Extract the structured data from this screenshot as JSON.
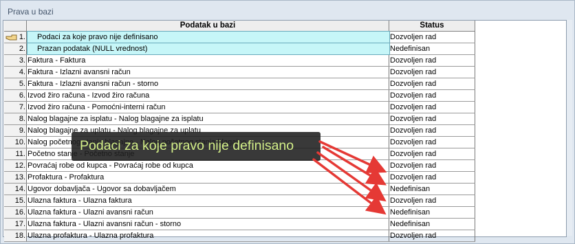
{
  "window": {
    "title": "Prava u bazi"
  },
  "table": {
    "columns": {
      "data": "Podatak u bazi",
      "status": "Status"
    },
    "rows": [
      {
        "num": "1.",
        "data": "Podaci za koje pravo nije definisano",
        "status": "Dozvoljen rad"
      },
      {
        "num": "2.",
        "data": "Prazan podatak (NULL vrednost)",
        "status": "Nedefinisan"
      },
      {
        "num": "3.",
        "data": "Faktura - Faktura",
        "status": "Dozvoljen rad"
      },
      {
        "num": "4.",
        "data": "Faktura - Izlazni avansni račun",
        "status": "Dozvoljen rad"
      },
      {
        "num": "5.",
        "data": "Faktura - Izlazni avansni račun - storno",
        "status": "Dozvoljen rad"
      },
      {
        "num": "6.",
        "data": "Izvod žiro računa - Izvod žiro računa",
        "status": "Dozvoljen rad"
      },
      {
        "num": "7.",
        "data": "Izvod žiro računa - Pomoćni-interni račun",
        "status": "Dozvoljen rad"
      },
      {
        "num": "8.",
        "data": "Nalog blagajne za isplatu - Nalog blagajne za isplatu",
        "status": "Dozvoljen rad"
      },
      {
        "num": "9.",
        "data": "Nalog blagajne za uplatu - Nalog blagajne za uplatu",
        "status": "Dozvoljen rad"
      },
      {
        "num": "10.",
        "data": "Nalog početnog stanja blagajne - Nalog početnog stanja blagajne",
        "status": "Dozvoljen rad"
      },
      {
        "num": "11.",
        "data": "Početno stanje - Početno stanje",
        "status": "Dozvoljen rad"
      },
      {
        "num": "12.",
        "data": "Povraćaj robe od kupca - Povraćaj robe od kupca",
        "status": "Dozvoljen rad"
      },
      {
        "num": "13.",
        "data": "Profaktura - Profaktura",
        "status": "Dozvoljen rad"
      },
      {
        "num": "14.",
        "data": "Ugovor dobavljača - Ugovor sa dobavljačem",
        "status": "Nedefinisan"
      },
      {
        "num": "15.",
        "data": "Ulazna faktura - Ulazna faktura",
        "status": "Dozvoljen rad"
      },
      {
        "num": "16.",
        "data": "Ulazna faktura - Ulazni avansni račun",
        "status": "Nedefinisan"
      },
      {
        "num": "17.",
        "data": "Ulazna faktura - Ulazni avansni račun - storno",
        "status": "Nedefinisan"
      },
      {
        "num": "18.",
        "data": "Ulazna profaktura - Ulazna profaktura",
        "status": "Dozvoljen rad"
      }
    ]
  },
  "tooltip": {
    "text": "Podaci za koje pravo nije definisano"
  },
  "icons": {
    "row_pointer": "pointing-hand-icon",
    "annotation": "red-arrow-icon"
  },
  "colors": {
    "highlight_row": "#c6f6f8",
    "tooltip_text": "#d4f089",
    "arrow": "#e53935"
  }
}
